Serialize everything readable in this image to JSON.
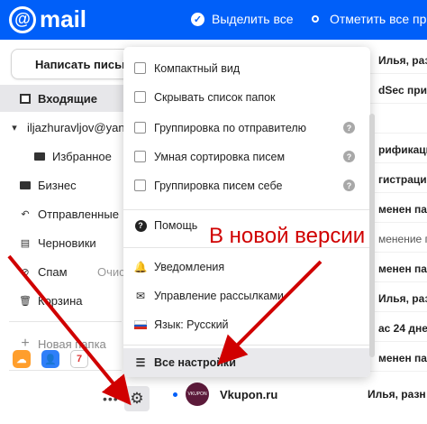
{
  "topbar": {
    "logo_text": "mail",
    "logo_symbol": "@",
    "select_all": "Выделить все",
    "mark_all_read": "Отметить все прочи"
  },
  "sidebar": {
    "compose": "Написать письмо",
    "items": [
      {
        "label": "Входящие",
        "icon": "inbox-icon"
      },
      {
        "label": "iljazhuravljov@yan",
        "icon": "chevron-down-icon"
      },
      {
        "label": "Избранное",
        "icon": "folder-icon"
      },
      {
        "label": "Бизнес",
        "icon": "folder-icon"
      },
      {
        "label": "Отправленные",
        "icon": "reply-icon"
      },
      {
        "label": "Черновики",
        "icon": "draft-icon"
      },
      {
        "label": "Спам",
        "icon": "spam-icon",
        "action": "Очист"
      },
      {
        "label": "Корзина",
        "icon": "trash-icon"
      }
    ],
    "new_folder": "Новая папка"
  },
  "menu": {
    "checkboxes": [
      {
        "label": "Компактный вид",
        "help": false
      },
      {
        "label": "Скрывать список папок",
        "help": false
      },
      {
        "label": "Группировка по отправителю",
        "help": true
      },
      {
        "label": "Умная сортировка писем",
        "help": true
      },
      {
        "label": "Группировка писем себе",
        "help": true
      }
    ],
    "help_mark": "?",
    "help": "Помощь",
    "notifications": "Уведомления",
    "subscriptions": "Управление рассылками",
    "language": "Язык: Русский",
    "all_settings": "Все настройки"
  },
  "mail_list": [
    "Илья, раз",
    "dSec при",
    "",
    "рификаци",
    "гистрации",
    "менен пар",
    "менение п",
    "менен пар",
    "Илья, раз",
    "ас 24 дне",
    "менен пар"
  ],
  "bottom_row": {
    "sender": "Vkupon.ru",
    "preview": "Илья, разн",
    "logo_text": "VKUPON"
  },
  "annotation": "В новой версии",
  "colors": {
    "brand_blue": "#005ff9",
    "annotation_red": "#d00000"
  }
}
